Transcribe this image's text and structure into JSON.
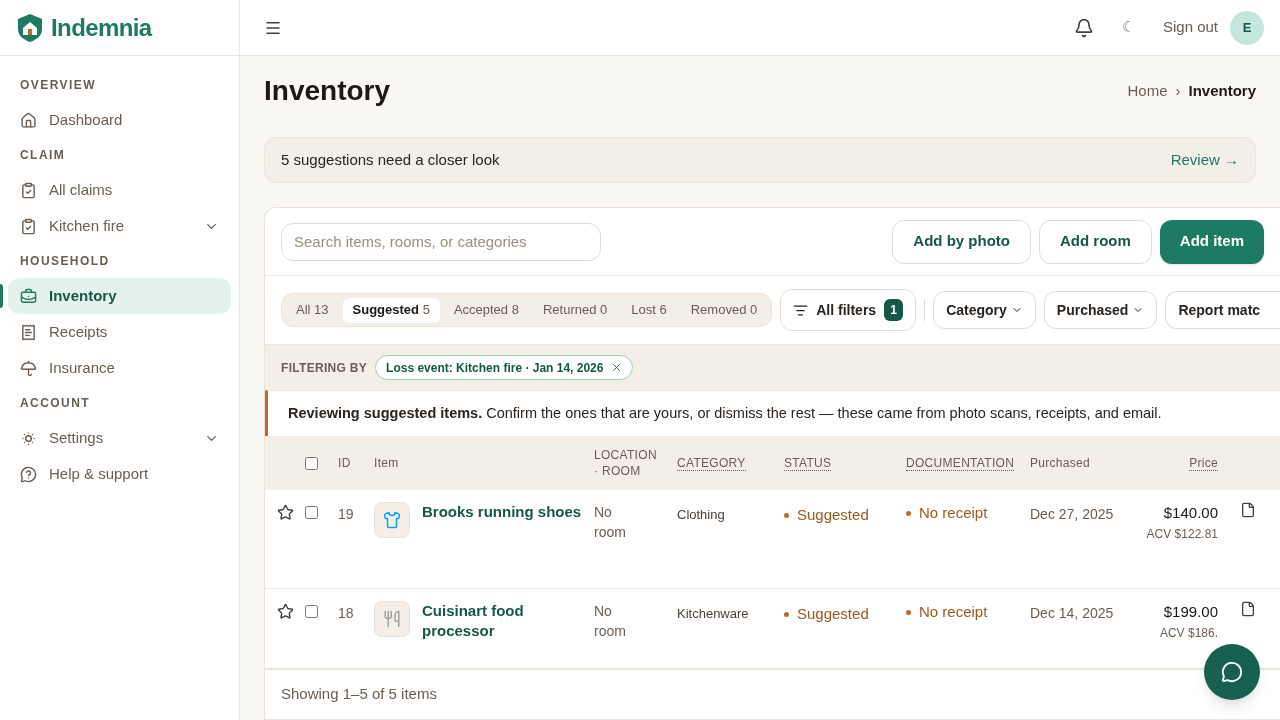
{
  "brand": {
    "name": "Indemnia"
  },
  "topbar": {
    "theme_toggle": "☾",
    "sign_out": "Sign out",
    "avatar": "E"
  },
  "sidebar": {
    "sections": [
      {
        "title": "OVERVIEW",
        "items": [
          {
            "label": "Dashboard",
            "kind": "home",
            "selected": false,
            "expandable": false
          }
        ]
      },
      {
        "title": "CLAIM",
        "items": [
          {
            "label": "All claims",
            "kind": "clipboard",
            "selected": false,
            "expandable": false
          },
          {
            "label": "Kitchen fire",
            "kind": "clipboard",
            "selected": false,
            "expandable": true
          }
        ]
      },
      {
        "title": "HOUSEHOLD",
        "items": [
          {
            "label": "Inventory",
            "kind": "briefcase",
            "selected": true,
            "expandable": false
          },
          {
            "label": "Receipts",
            "kind": "receipt",
            "selected": false,
            "expandable": false
          },
          {
            "label": "Insurance",
            "kind": "umbrella",
            "selected": false,
            "expandable": false
          }
        ]
      },
      {
        "title": "ACCOUNT",
        "items": [
          {
            "label": "Settings",
            "kind": "settings",
            "selected": false,
            "expandable": true
          },
          {
            "label": "Help & support",
            "kind": "help",
            "selected": false,
            "expandable": false
          }
        ]
      }
    ]
  },
  "page": {
    "title": "Inventory",
    "breadcrumb": [
      "Home",
      "Inventory"
    ],
    "breadcrumb_separator": "›"
  },
  "notice": {
    "text": "5 suggestions need a closer look",
    "action": "Review →"
  },
  "search": {
    "placeholder": "Search items, rooms, or categories"
  },
  "actions": [
    {
      "label": "Add by photo",
      "primary": false
    },
    {
      "label": "Add room",
      "primary": false
    },
    {
      "label": "Add item",
      "primary": true
    }
  ],
  "status_tabs": [
    {
      "label": "All",
      "count": "13",
      "selected": false
    },
    {
      "label": "Suggested",
      "count": "5",
      "selected": true
    },
    {
      "label": "Accepted",
      "count": "8",
      "selected": false
    },
    {
      "label": "Returned",
      "count": "0",
      "selected": false
    },
    {
      "label": "Lost",
      "count": "6",
      "selected": false
    },
    {
      "label": "Removed",
      "count": "0",
      "selected": false
    }
  ],
  "all_filters": {
    "label": "All filters",
    "count": "1"
  },
  "dropdowns": [
    {
      "label": "Category",
      "caret": true
    },
    {
      "label": "Purchased",
      "caret": true
    },
    {
      "label": "Report matc",
      "caret": false
    }
  ],
  "filtering": {
    "label": "FILTERING BY",
    "chips": [
      "Loss event: Kitchen fire · Jan 14, 2026"
    ]
  },
  "review_banner": "**Reviewing suggested items.** Confirm the ones that are yours, or dismiss the rest — these came from photo scans, receipts, and email.",
  "table": {
    "select_all": {
      "checked": false
    },
    "columns": [
      {
        "label": "ID",
        "sortable": false
      },
      {
        "label": "Item",
        "sortable": false
      },
      {
        "label": "LOCATION · ROOM",
        "sortable": false
      },
      {
        "label": "CATEGORY",
        "sortable": true
      },
      {
        "label": "STATUS",
        "sortable": true
      },
      {
        "label": "DOCUMENTATION",
        "sortable": true
      },
      {
        "label": "Purchased",
        "sortable": false
      },
      {
        "label": "Price",
        "sortable": true
      }
    ],
    "rows": [
      {
        "starred": false,
        "checked": false,
        "id": "19",
        "kind": "clothing",
        "name": "Brooks running shoes",
        "location": "No room",
        "category": "Clothing",
        "status": "Suggested",
        "documentation": "No receipt",
        "purchased": "Dec 27, 2025",
        "price": "$140.00",
        "acv": "ACV $122.81"
      },
      {
        "starred": false,
        "checked": false,
        "id": "18",
        "kind": "kitchen",
        "name": "Cuisinart food processor",
        "location": "No room",
        "category": "Kitchenware",
        "status": "Suggested",
        "documentation": "No receipt",
        "purchased": "Dec 14, 2025",
        "price": "$199.00",
        "acv": "ACV $186."
      }
    ]
  },
  "footer": "Showing 1–5 of 5 items"
}
